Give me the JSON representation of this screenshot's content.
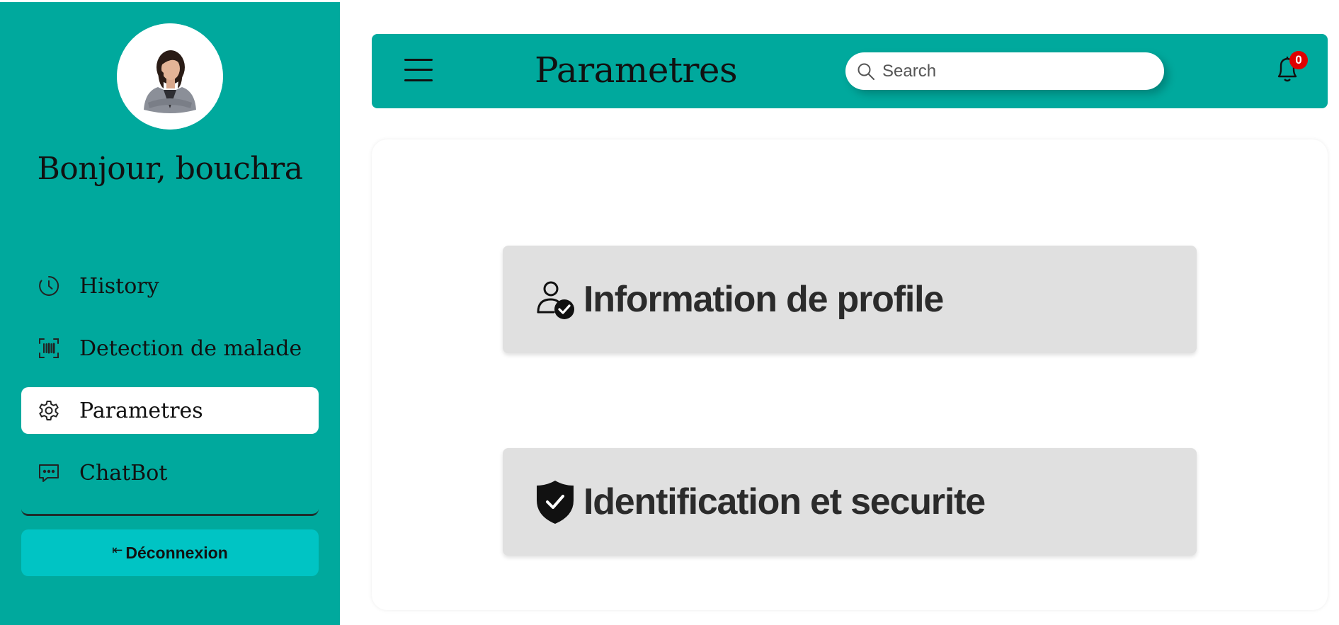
{
  "sidebar": {
    "greeting": "Bonjour, bouchra",
    "items": [
      {
        "label": "History",
        "icon": "history-icon",
        "active": false
      },
      {
        "label": "Detection de malade",
        "icon": "barcode-scan-icon",
        "active": false
      },
      {
        "label": "Parametres",
        "icon": "gear-icon",
        "active": true
      },
      {
        "label": "ChatBot",
        "icon": "chat-message-icon",
        "active": false
      }
    ],
    "logout_label": "Déconnexion",
    "logout_icon": "logout-arrow-icon"
  },
  "header": {
    "title": "Parametres",
    "search_placeholder": "Search",
    "notification_count": "0"
  },
  "main": {
    "options": [
      {
        "label": "Information de profile",
        "icon": "user-check-icon"
      },
      {
        "label": "Identification et securite",
        "icon": "shield-check-icon"
      }
    ]
  },
  "colors": {
    "sidebar_bg": "#00a99d",
    "topbar_bg": "#00a99d",
    "logout_bg": "#00c4c4",
    "option_bg": "#e0e0e0",
    "badge_bg": "#e00000"
  }
}
